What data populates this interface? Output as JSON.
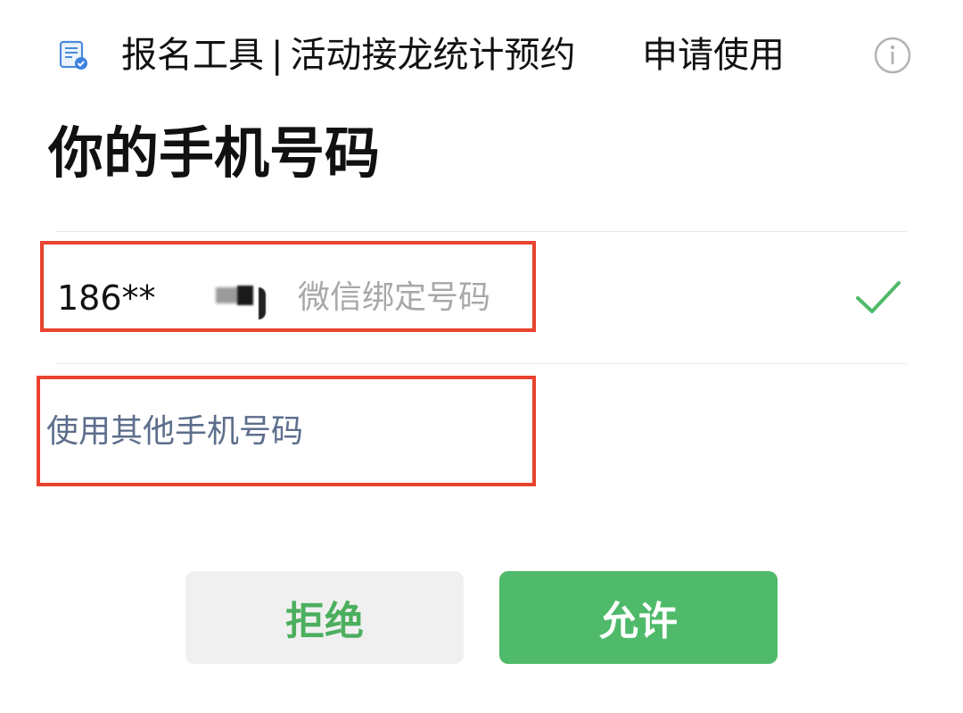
{
  "header": {
    "app_name": "报名工具",
    "separator": "|",
    "app_subtitle": "活动接龙统计预约",
    "action": "申请使用",
    "app_icon": "document-check-icon",
    "info_icon": "info-icon"
  },
  "title": "你的手机号码",
  "phone": {
    "number": "186**",
    "label": "微信绑定号码",
    "selected": true,
    "check_icon": "check-icon"
  },
  "other_number_label": "使用其他手机号码",
  "buttons": {
    "reject": "拒绝",
    "allow": "允许"
  },
  "colors": {
    "accent_green": "#4fba6a",
    "link_blue_gray": "#5d6e8c",
    "highlight_red": "#e8432e"
  }
}
